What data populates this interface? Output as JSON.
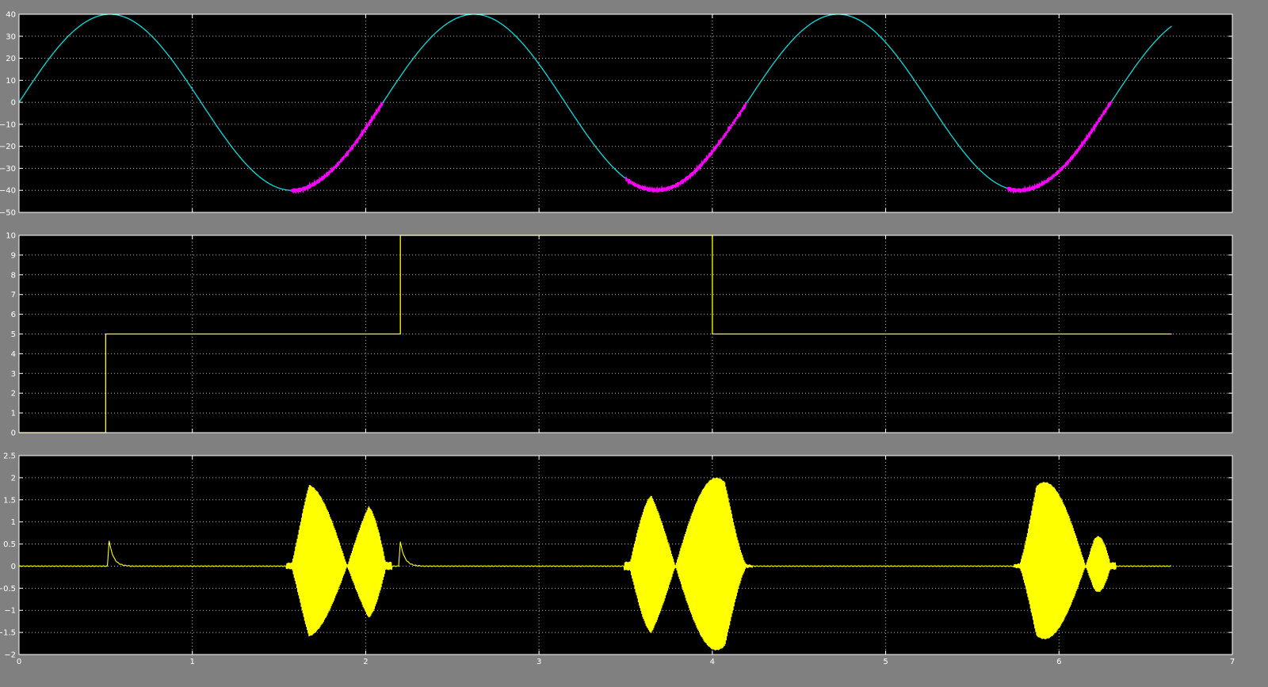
{
  "window": {
    "background": "#808080",
    "axes_background": "#000000",
    "grid_color": "#b0b0b0"
  },
  "chart_data": [
    {
      "type": "line",
      "title": "",
      "xlabel": "",
      "ylabel": "",
      "xlim": [
        0,
        7
      ],
      "ylim": [
        -50,
        40
      ],
      "xticks": [
        0,
        1,
        2,
        3,
        4,
        5,
        6,
        7
      ],
      "yticks": [
        -50,
        -40,
        -30,
        -20,
        -10,
        0,
        10,
        20,
        30,
        40
      ],
      "show_xtick_labels": false,
      "grid": true,
      "series": [
        {
          "color": "#00e0e0",
          "kind": "sine",
          "amplitude": 40,
          "period": 2.1,
          "x_end": 6.65
        },
        {
          "color": "#ff00ff",
          "kind": "sine-segments",
          "amplitude": 40,
          "period": 2.1,
          "segments": [
            [
              1.57,
              2.1
            ],
            [
              3.5,
              4.2
            ],
            [
              5.7,
              6.3
            ]
          ]
        }
      ]
    },
    {
      "type": "line",
      "title": "",
      "xlabel": "",
      "ylabel": "",
      "xlim": [
        0,
        7
      ],
      "ylim": [
        0,
        10
      ],
      "xticks": [
        0,
        1,
        2,
        3,
        4,
        5,
        6,
        7
      ],
      "yticks": [
        0,
        1,
        2,
        3,
        4,
        5,
        6,
        7,
        8,
        9,
        10
      ],
      "show_xtick_labels": false,
      "grid": true,
      "series": [
        {
          "color": "#ffff00",
          "kind": "step",
          "x": [
            0,
            0.5,
            0.5,
            2.2,
            2.2,
            4.0,
            4.0,
            6.65
          ],
          "y": [
            0,
            0,
            5,
            5,
            10,
            10,
            5,
            5
          ]
        }
      ]
    },
    {
      "type": "line",
      "title": "",
      "xlabel": "",
      "ylabel": "",
      "xlim": [
        0,
        7
      ],
      "ylim": [
        -2,
        2.5
      ],
      "xticks": [
        0,
        1,
        2,
        3,
        4,
        5,
        6,
        7
      ],
      "yticks": [
        -2,
        -1.5,
        -1,
        -0.5,
        0,
        0.5,
        1,
        1.5,
        2,
        2.5
      ],
      "show_xtick_labels": true,
      "grid": true,
      "series": [
        {
          "color": "#ffff00",
          "kind": "bursts",
          "x_end": 6.65,
          "spikes": [
            {
              "x": 0.52,
              "height": 0.58
            },
            {
              "x": 2.2,
              "height": 0.55
            }
          ],
          "bursts": [
            {
              "x0": 1.57,
              "x1": 2.12,
              "upper": 1.85,
              "lower": -1.6
            },
            {
              "x0": 3.52,
              "x1": 4.2,
              "upper": 2.0,
              "lower": -1.9
            },
            {
              "x0": 5.77,
              "x1": 6.3,
              "upper": 1.9,
              "lower": -1.65
            }
          ]
        }
      ]
    }
  ]
}
